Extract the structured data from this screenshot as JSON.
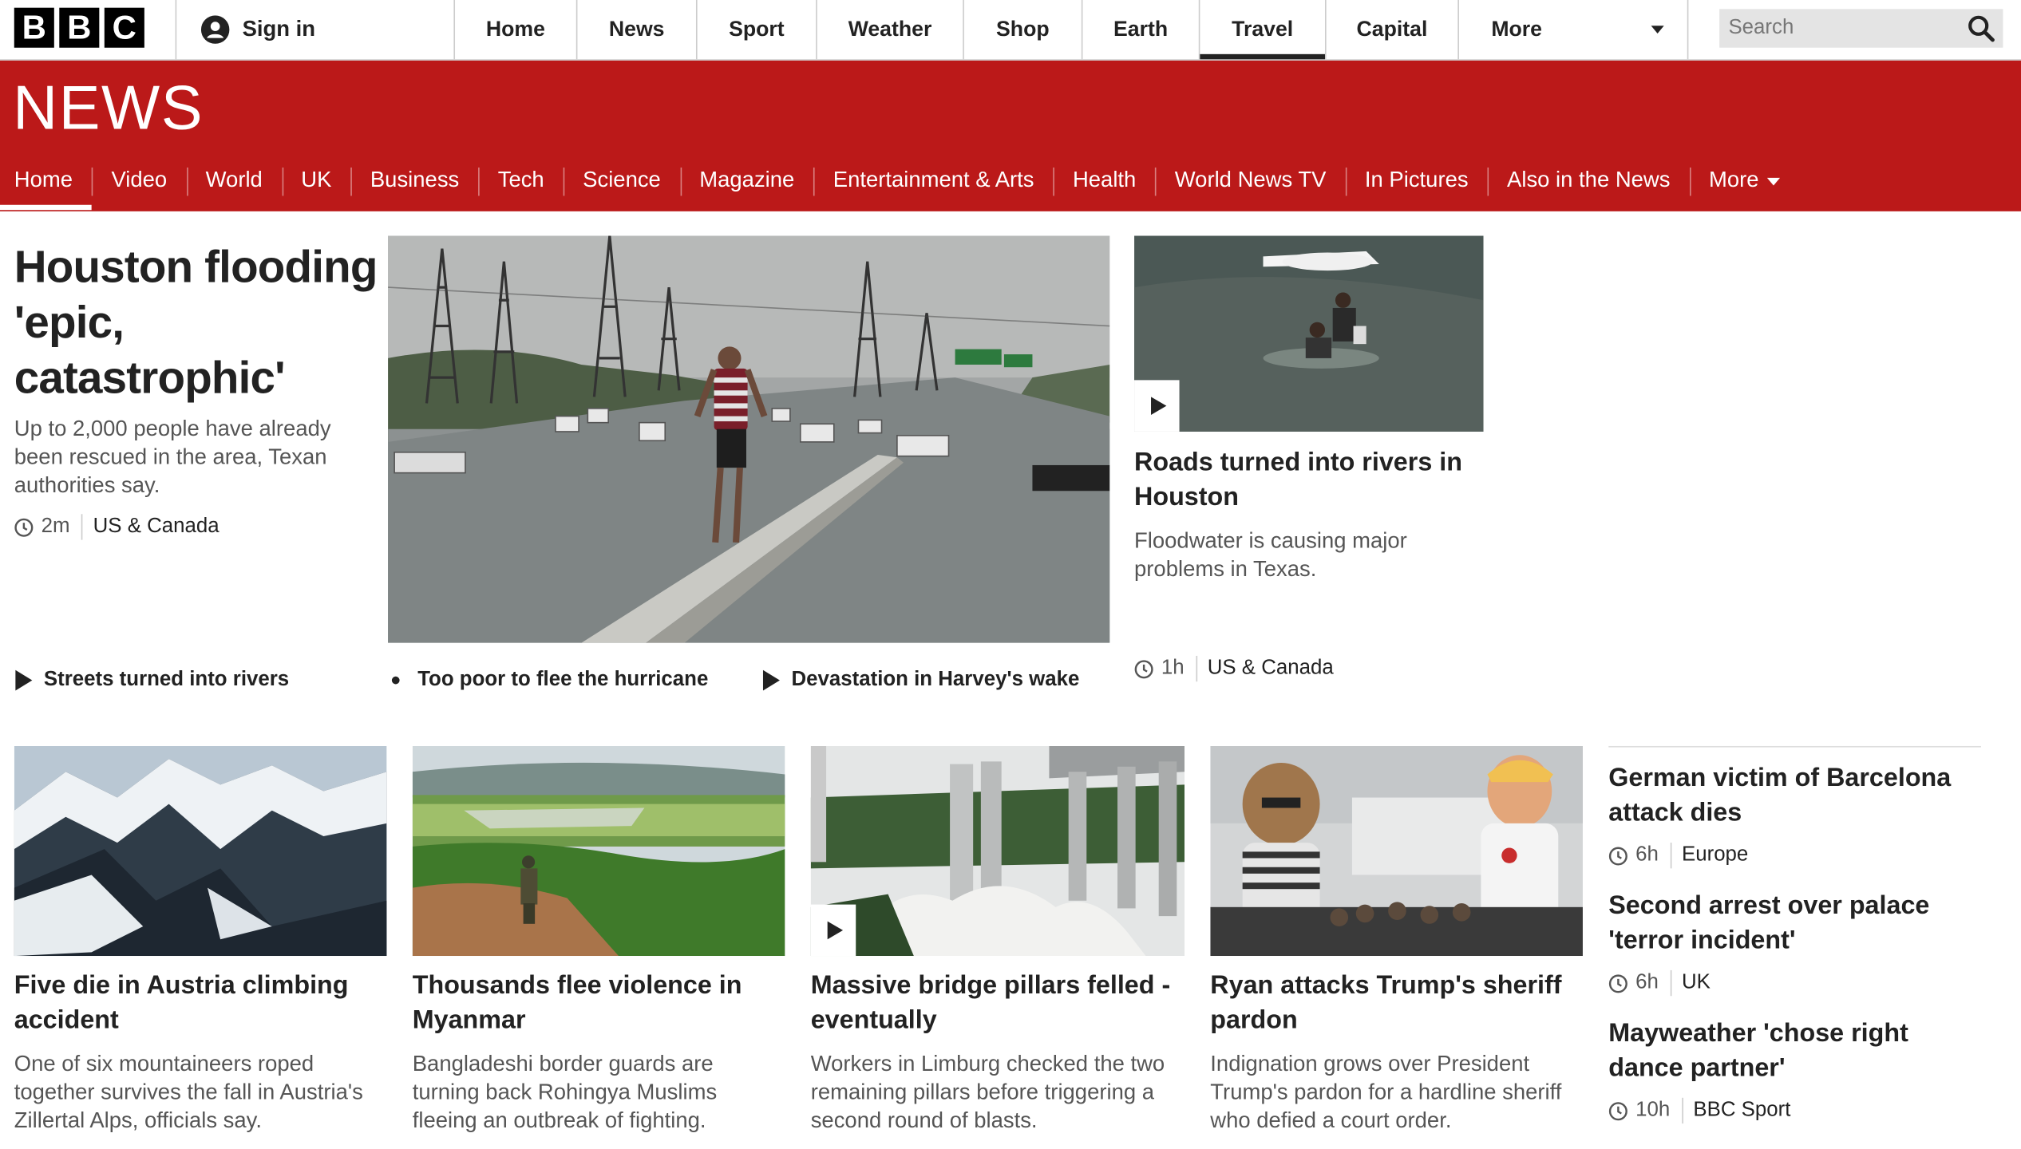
{
  "header": {
    "logo_letters": [
      "B",
      "B",
      "C"
    ],
    "signin_label": "Sign in",
    "nav": [
      "Home",
      "News",
      "Sport",
      "Weather",
      "Shop",
      "Earth",
      "Travel",
      "Capital",
      "More"
    ],
    "active_nav": "Travel",
    "search_placeholder": "Search"
  },
  "news_bar": {
    "logo": "NEWS",
    "nav": [
      "Home",
      "Video",
      "World",
      "UK",
      "Business",
      "Tech",
      "Science",
      "Magazine",
      "Entertainment & Arts",
      "Health",
      "World News TV",
      "In Pictures",
      "Also in the News",
      "More"
    ],
    "active_nav": "Home",
    "brand_color": "#bb1919"
  },
  "lead": {
    "title": "Houston flooding 'epic, catastrophic'",
    "summary": "Up to 2,000 people have already been rescued in the area, Texan authorities say.",
    "time": "2m",
    "section": "US & Canada",
    "related": [
      {
        "label": "Streets turned into rivers",
        "icon": "play-icon"
      },
      {
        "label": "Too poor to flee the hurricane",
        "icon": "bullet-icon"
      },
      {
        "label": "Devastation in Harvey's wake",
        "icon": "play-icon"
      }
    ]
  },
  "secondary": {
    "title": "Roads turned into rivers in Houston",
    "summary": "Floodwater is causing major problems in Texas.",
    "time": "1h",
    "section": "US & Canada"
  },
  "stories": [
    {
      "title": "Five die in Austria climbing accident",
      "summary": "One of six mountaineers roped together survives the fall in Austria's Zillertal Alps, officials say."
    },
    {
      "title": "Thousands flee violence in Myanmar",
      "summary": "Bangladeshi border guards are turning back Rohingya Muslims fleeing an outbreak of fighting."
    },
    {
      "title": "Massive bridge pillars felled - eventually",
      "summary": "Workers in Limburg checked the two remaining pillars before triggering a second round of blasts."
    },
    {
      "title": "Ryan attacks Trump's sheriff pardon",
      "summary": "Indignation grows over President Trump's pardon for a hardline sheriff who defied a court order."
    }
  ],
  "sidebar": [
    {
      "title": "German victim of Barcelona attack dies",
      "time": "6h",
      "section": "Europe"
    },
    {
      "title": "Second arrest over palace 'terror incident'",
      "time": "6h",
      "section": "UK"
    },
    {
      "title": "Mayweather 'chose right dance partner'",
      "time": "10h",
      "section": "BBC Sport"
    }
  ]
}
